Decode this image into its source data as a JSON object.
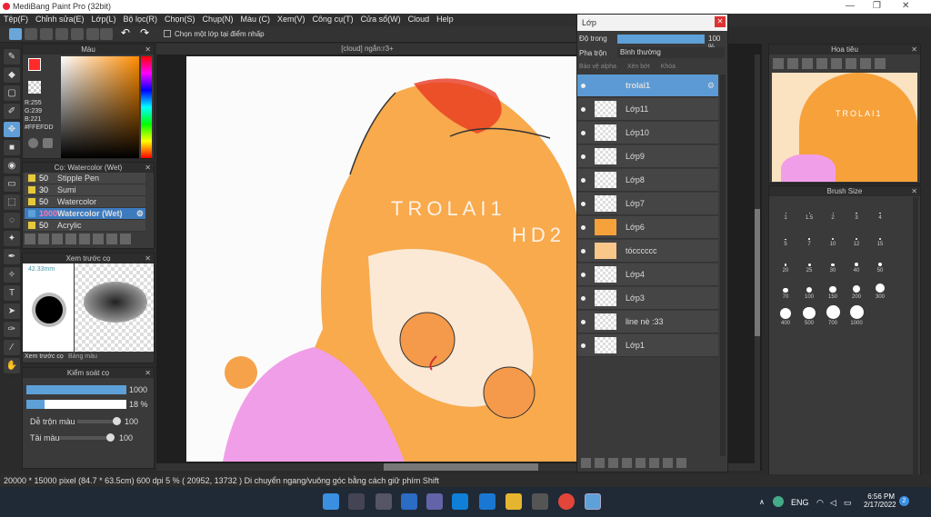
{
  "app": {
    "title": "MediBang Paint Pro (32bit)",
    "window_controls": [
      "—",
      "❐",
      "✕"
    ]
  },
  "menu": [
    "Tệp(F)",
    "Chỉnh sửa(E)",
    "Lớp(L)",
    "Bộ lọc(R)",
    "Chọn(S)",
    "Chụp(N)",
    "Màu (C)",
    "Xem(V)",
    "Công cụ(T)",
    "Cửa sổ(W)",
    "Cloud",
    "Help"
  ],
  "toolbar": {
    "select_layer_label": "Chọn một lớp tại điểm nhấp"
  },
  "color_panel": {
    "title": "Màu",
    "rgb": [
      "R:255",
      "G:239",
      "B:221"
    ],
    "hex": "#FFEFDD",
    "current_color": "#ff2a2a"
  },
  "brush_panel": {
    "title": "Cọ: Watercolor (Wet)",
    "items": [
      {
        "size": "50",
        "name": "Stipple Pen",
        "selected": false
      },
      {
        "size": "30",
        "name": "Sumi",
        "selected": false
      },
      {
        "size": "50",
        "name": "Watercolor",
        "selected": false
      },
      {
        "size": "1000",
        "name": "Watercolor (Wet)",
        "selected": true
      },
      {
        "size": "50",
        "name": "Acrylic",
        "selected": false
      }
    ]
  },
  "preview_panel": {
    "title": "Xem trước cọ",
    "size": "42.33mm",
    "tab1": "Xem trước cọ",
    "tab2": "Bảng màu"
  },
  "control_panel": {
    "title": "Kiểm soát cọ",
    "size_value": "1000",
    "opacity_value": "18 %",
    "size_fill": 1.0,
    "opacity_fill": 0.18,
    "blend_label": "Dễ trộn màu",
    "blend_value": "100",
    "load_label": "Tải màu",
    "load_value": "100"
  },
  "canvas": {
    "tab": "[cloud] ngắn:r3+",
    "watermark1": "TROLAI1",
    "watermark2": "HD2"
  },
  "layer_panel": {
    "title": "Lớp",
    "opacity_label": "Độ trong",
    "opacity_value": "100 %",
    "blend_label": "Pha trộn",
    "blend_value": "Bình thường",
    "protect_alpha": "Bảo vệ alpha",
    "clipping": "Xén bớt",
    "lock": "Khóa",
    "layers": [
      "trolai1",
      "Lớp11",
      "Lớp10",
      "Lớp9",
      "Lớp8",
      "Lớp7",
      "Lớp6",
      "tócccccc",
      "Lớp4",
      "Lớp3",
      "line nè :33",
      "Lớp1"
    ]
  },
  "navigator": {
    "title": "Hoa tiêu",
    "watermark": "TROLAI1"
  },
  "brush_size": {
    "title": "Brush Size",
    "sizes": [
      "1",
      "1.5",
      "2",
      "3",
      "4",
      "5",
      "7",
      "10",
      "12",
      "15",
      "20",
      "25",
      "30",
      "40",
      "50",
      "70",
      "100",
      "150",
      "200",
      "300",
      "400",
      "500",
      "700",
      "1000"
    ]
  },
  "status": {
    "text": "20000 * 15000 pixel  (84.7 * 63.5cm)  600 dpi  5 %  ( 20952, 13732 )  Di chuyển ngang/vuông góc bằng cách giữ phím Shift"
  },
  "taskbar": {
    "lang": "ENG",
    "time": "6:56 PM",
    "date": "2/17/2022",
    "badge": "2"
  }
}
